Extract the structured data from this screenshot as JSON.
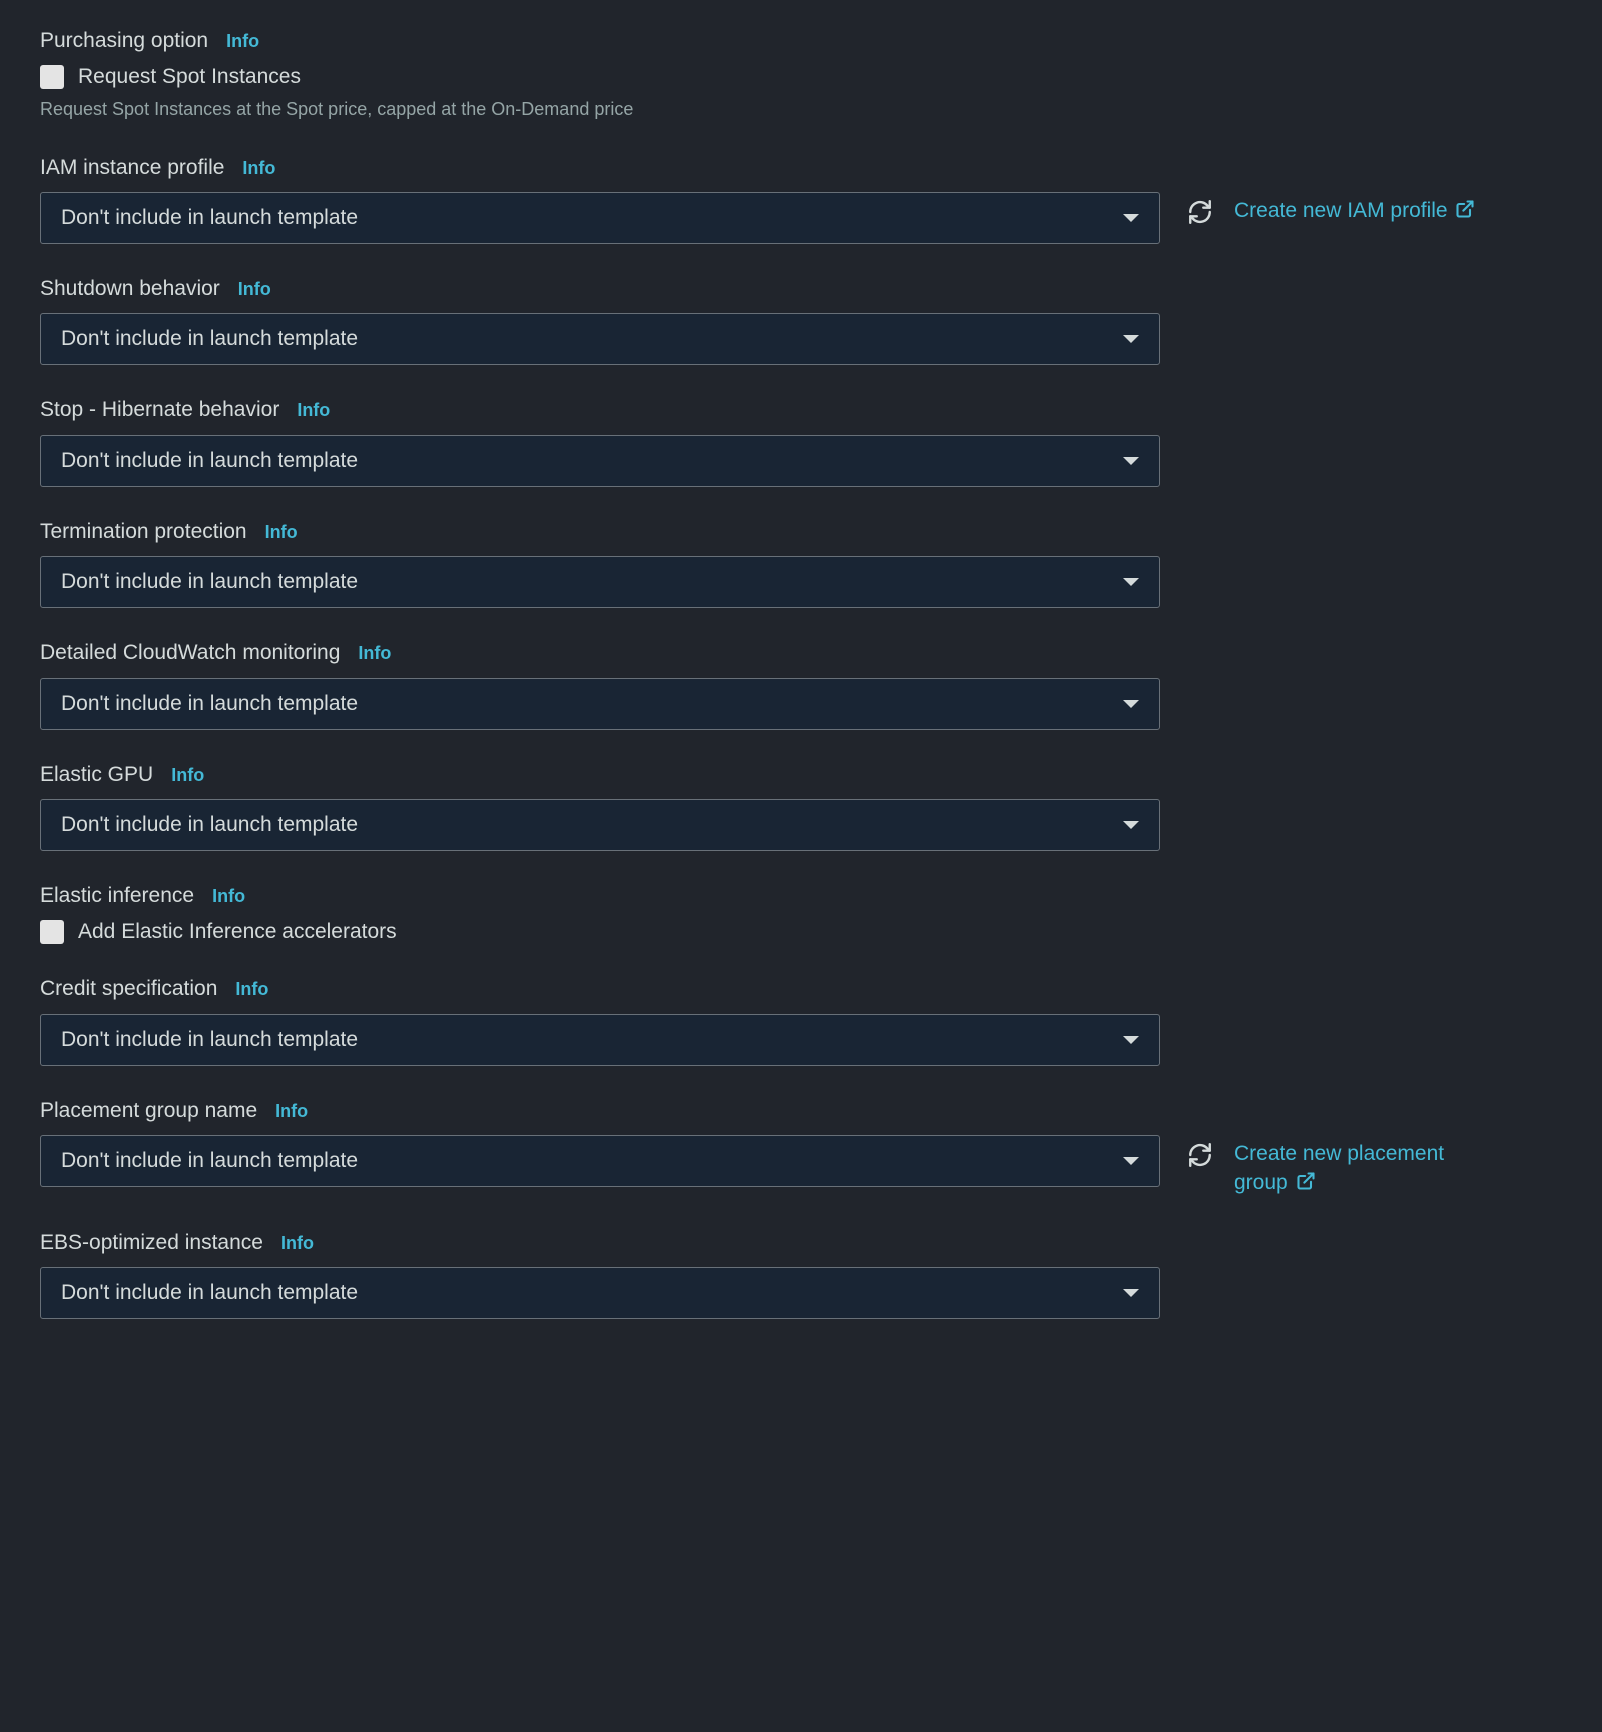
{
  "info_label": "Info",
  "default_select": "Don't include in launch template",
  "purchasing": {
    "title": "Purchasing option",
    "checkbox_label": "Request Spot Instances",
    "help": "Request Spot Instances at the Spot price, capped at the On-Demand price"
  },
  "iam_profile": {
    "title": "IAM instance profile",
    "create_link": "Create new IAM profile"
  },
  "shutdown": {
    "title": "Shutdown behavior"
  },
  "hibernate": {
    "title": "Stop - Hibernate behavior"
  },
  "termination": {
    "title": "Termination protection"
  },
  "cloudwatch": {
    "title": "Detailed CloudWatch monitoring"
  },
  "elastic_gpu": {
    "title": "Elastic GPU"
  },
  "elastic_inference": {
    "title": "Elastic inference",
    "checkbox_label": "Add Elastic Inference accelerators"
  },
  "credit": {
    "title": "Credit specification"
  },
  "placement": {
    "title": "Placement group name",
    "create_link": "Create new placement group"
  },
  "ebs": {
    "title": "EBS-optimized instance"
  }
}
